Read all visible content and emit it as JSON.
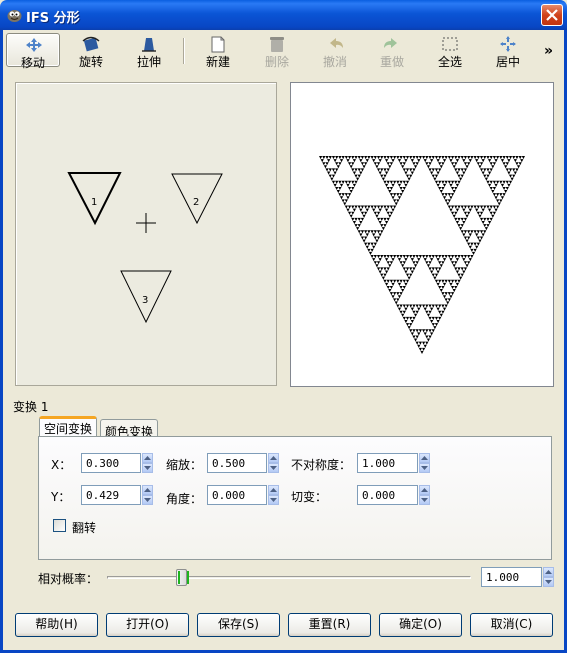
{
  "window": {
    "title": "IFS 分形"
  },
  "toolbar": {
    "move": "移动",
    "rotate": "旋转",
    "stretch": "拉伸",
    "new": "新建",
    "delete": "删除",
    "undo": "撤消",
    "redo": "重做",
    "select_all": "全选",
    "center": "居中",
    "overflow": "»"
  },
  "design": {
    "transforms": [
      {
        "label": "1",
        "selected": true
      },
      {
        "label": "2",
        "selected": false
      },
      {
        "label": "3",
        "selected": false
      }
    ],
    "center_marker": "+"
  },
  "transform_label": "变换 1",
  "tabs": {
    "spatial": "空间变换",
    "color": "颜色变换"
  },
  "fields": {
    "x_label": "X：",
    "x_value": "0.300",
    "y_label": "Y：",
    "y_value": "0.429",
    "scale_label": "缩放：",
    "scale_value": "0.500",
    "angle_label": "角度：",
    "angle_value": "0.000",
    "asym_label": "不对称度：",
    "asym_value": "1.000",
    "shear_label": "切变：",
    "shear_value": "0.000",
    "flip_label": "翻转",
    "flip_checked": false
  },
  "probability": {
    "label": "相对概率：",
    "value": "1.000",
    "slider_fraction": 0.2
  },
  "buttons": {
    "help": "帮助(H)",
    "open": "打开(O)",
    "save": "保存(S)",
    "reset": "重置(R)",
    "ok": "确定(O)",
    "cancel": "取消(C)"
  },
  "preview": {
    "fractal": "sierpinski-triangle",
    "levels": 6
  }
}
